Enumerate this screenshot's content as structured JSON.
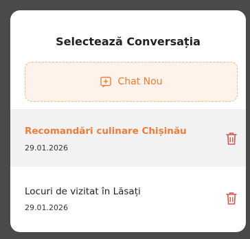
{
  "dialog": {
    "title": "Selectează Conversația",
    "new_chat_label": "Chat Nou"
  },
  "conversations": [
    {
      "title": "Recomandări culinare Chișinău",
      "date": "29.01.2026",
      "active": true
    },
    {
      "title": "Locuri de vizitat în Lăsați",
      "date": "29.01.2026",
      "active": false
    }
  ],
  "icons": {
    "new_chat": "plus-square-icon",
    "delete": "trash-icon"
  },
  "colors": {
    "accent": "#ee7c3a",
    "accent_bg": "#fdf3ea",
    "active_row_bg": "#f2f2f2",
    "delete_icon": "#d9534f",
    "backdrop": "#4a4a4a"
  }
}
